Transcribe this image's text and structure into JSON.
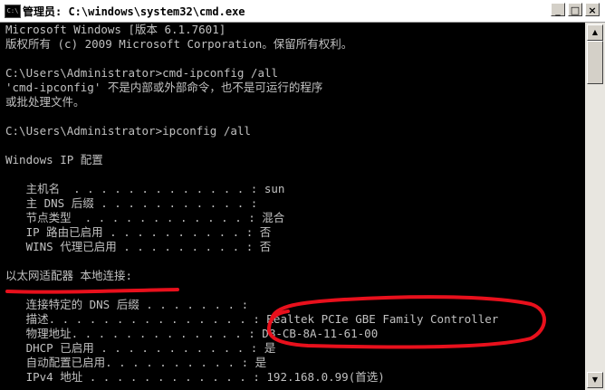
{
  "window": {
    "title": "管理员: C:\\windows\\system32\\cmd.exe",
    "icon_label": "C:\\",
    "minimize_glyph": "_",
    "maximize_glyph": "□",
    "close_glyph": "×"
  },
  "console": {
    "lines": [
      "Microsoft Windows [版本 6.1.7601]",
      "版权所有 (c) 2009 Microsoft Corporation。保留所有权利。",
      "",
      "C:\\Users\\Administrator>cmd-ipconfig /all",
      "'cmd-ipconfig' 不是内部或外部命令，也不是可运行的程序",
      "或批处理文件。",
      "",
      "C:\\Users\\Administrator>ipconfig /all",
      "",
      "Windows IP 配置",
      "",
      "   主机名  . . . . . . . . . . . . . : sun",
      "   主 DNS 后缀 . . . . . . . . . . . :",
      "   节点类型  . . . . . . . . . . . . : 混合",
      "   IP 路由已启用 . . . . . . . . . . : 否",
      "   WINS 代理已启用 . . . . . . . . . : 否",
      "",
      "以太网适配器 本地连接:",
      "",
      "   连接特定的 DNS 后缀 . . . . . . . :",
      "   描述. . . . . . . . . . . . . . . : Realtek PCIe GBE Family Controller",
      "   物理地址. . . . . . . . . . . . . : D8-CB-8A-11-61-00",
      "   DHCP 已启用 . . . . . . . . . . . : 是",
      "   自动配置已启用. . . . . . . . . . : 是",
      "   IPv4 地址 . . . . . . . . . . . . : 192.168.0.99(首选)"
    ]
  },
  "colors": {
    "console_bg": "#000000",
    "console_text": "#c0c0c0",
    "annotation": "#e8101c"
  },
  "scrollbar": {
    "up_glyph": "▲",
    "down_glyph": "▼"
  }
}
